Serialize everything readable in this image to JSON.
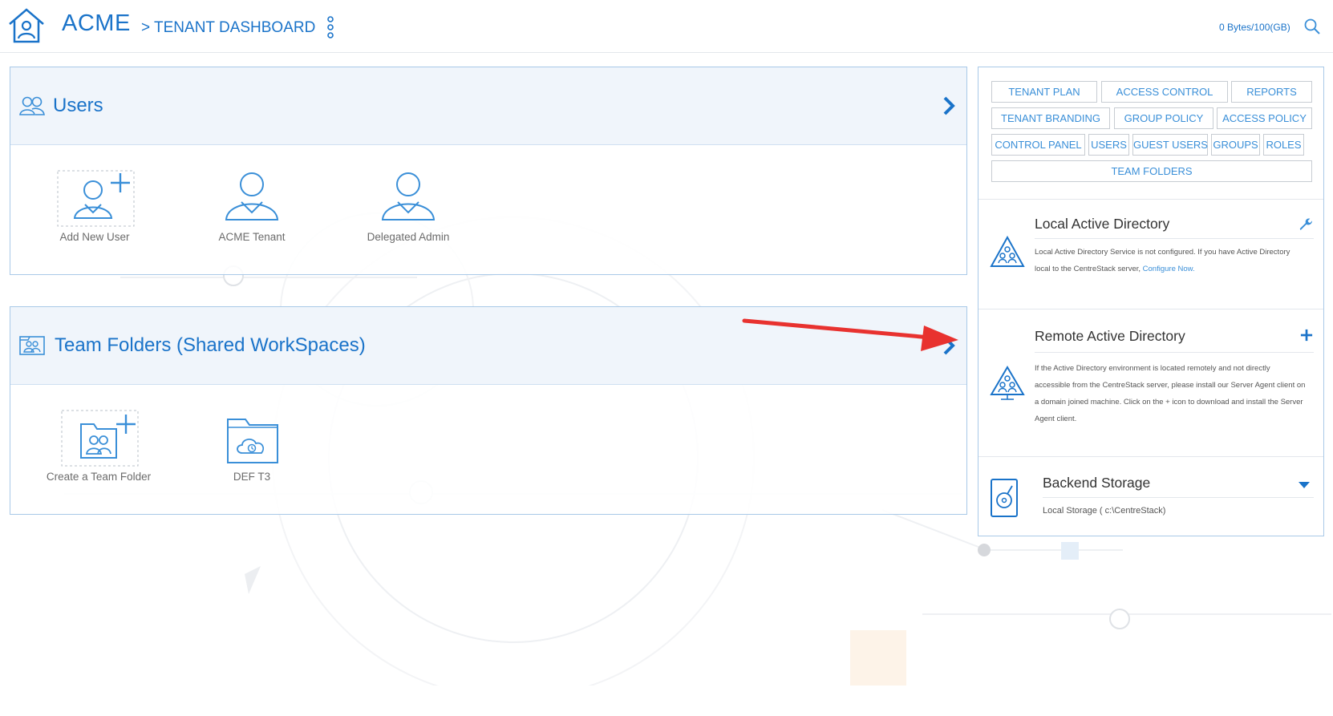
{
  "header": {
    "brand": "ACME",
    "breadcrumb": "> TENANT DASHBOARD",
    "storage_usage": "0 Bytes/100(GB)",
    "home_icon": "home-icon",
    "menu_icon": "kebab-menu-icon",
    "search_icon": "search-icon"
  },
  "users_panel": {
    "title": "Users",
    "tiles": [
      {
        "label": "Add New User",
        "icon": "add-user-icon"
      },
      {
        "label": "ACME Tenant",
        "icon": "user-icon"
      },
      {
        "label": "Delegated Admin",
        "icon": "user-icon"
      }
    ]
  },
  "team_folders_panel": {
    "title": "Team Folders (Shared WorkSpaces)",
    "tiles": [
      {
        "label": "Create a Team Folder",
        "icon": "add-team-folder-icon"
      },
      {
        "label": "DEF T3",
        "icon": "cloud-folder-icon"
      }
    ]
  },
  "settings_buttons": [
    "TENANT PLAN",
    "ACCESS CONTROL",
    "REPORTS",
    "TENANT BRANDING",
    "GROUP POLICY",
    "ACCESS POLICY",
    "CONTROL PANEL",
    "USERS",
    "GUEST USERS",
    "GROUPS",
    "ROLES",
    "TEAM FOLDERS"
  ],
  "local_ad": {
    "title": "Local Active Directory",
    "text": "Local Active Directory Service is not configured. If you have Active Directory local to the CentreStack server,",
    "link": "Configure Now."
  },
  "remote_ad": {
    "title": "Remote Active Directory",
    "text": "If the Active Directory environment is located remotely and not directly accessible from the CentreStack server, please install our Server Agent client on a domain joined machine. Click on the + icon to download and install the Server Agent client."
  },
  "backend_storage": {
    "title": "Backend Storage",
    "detail": "Local Storage ( c:\\CentreStack)"
  },
  "colors": {
    "accent": "#1a73c9",
    "panel_border": "#a9c9e8",
    "annotation_arrow": "#e8322f"
  }
}
